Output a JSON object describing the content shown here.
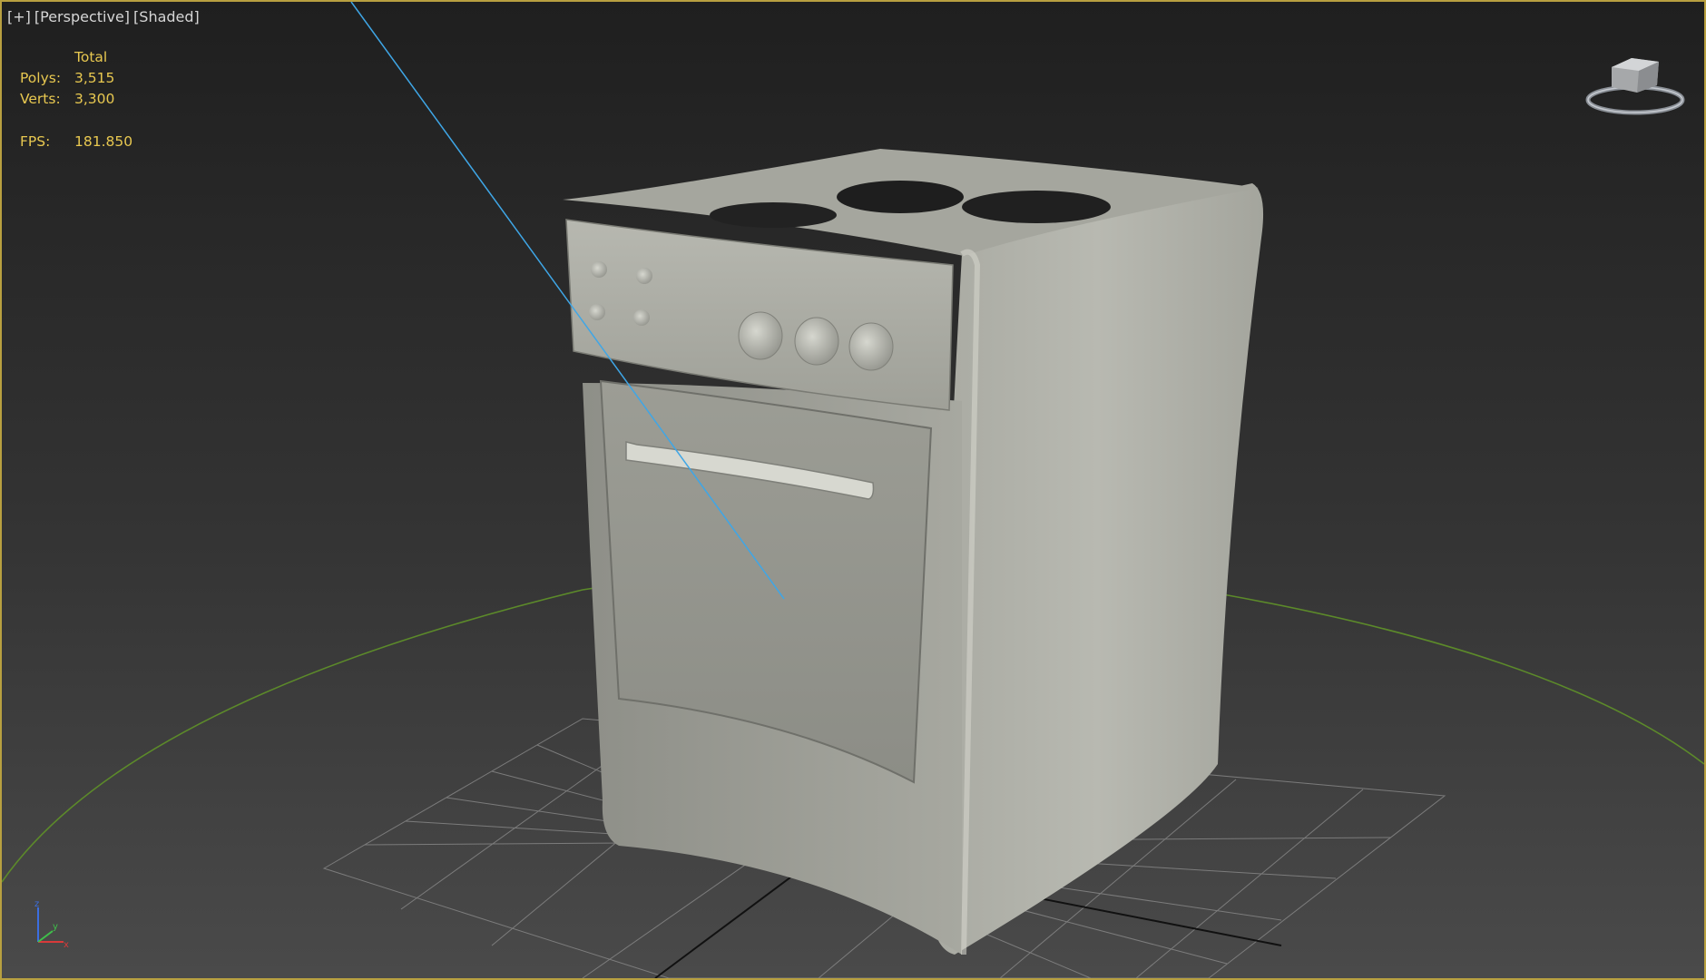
{
  "viewport": {
    "labels": {
      "plus": "[+]",
      "view": "[Perspective]",
      "shading": "[Shaded]"
    },
    "stats": {
      "header": "Total",
      "polys_label": "Polys:",
      "polys_value": "3,515",
      "verts_label": "Verts:",
      "verts_value": "3,300",
      "fps_label": "FPS:",
      "fps_value": "181.850"
    },
    "viewcube": {
      "icon": "viewcube-icon"
    },
    "axis": {
      "z": "z",
      "y": "y",
      "x": "x"
    }
  },
  "colors": {
    "viewport_border": "#b8a040",
    "stats_text": "#e8c850",
    "grid_line": "#8a8a8a",
    "ground_circle": "#5c8a2a",
    "light_ray": "#3fa6e6",
    "object_body": "#b9bab2"
  }
}
